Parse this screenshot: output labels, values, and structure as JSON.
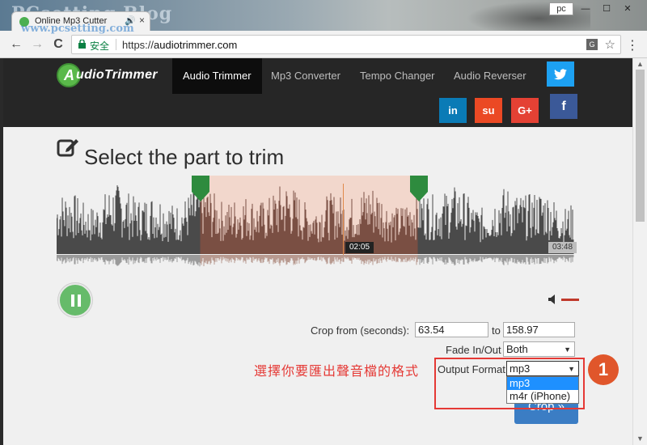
{
  "browser": {
    "watermark_top": "PCsetting Blog",
    "watermark_url": "www.pcsetting.com",
    "tab_title": "Online Mp3 Cutter",
    "tab_audio_icon": "speaker-icon",
    "tab_close": "×",
    "profile": "pc",
    "minimize": "—",
    "maximize": "☐",
    "close": "✕",
    "back": "←",
    "forward": "→",
    "reload": "C",
    "secure_label": "安全",
    "url_scheme": "https://",
    "url_host": "audiotrimmer.com",
    "translate_icon": "G",
    "bookmark": "☆",
    "menu": "⋮"
  },
  "site": {
    "logo_letter": "A",
    "logo_text": "udioTrimmer",
    "nav": [
      {
        "label": "Audio Trimmer",
        "active": true
      },
      {
        "label": "Mp3 Converter",
        "active": false
      },
      {
        "label": "Tempo Changer",
        "active": false
      },
      {
        "label": "Audio Reverser",
        "active": false
      }
    ],
    "social": [
      {
        "label": "twitter",
        "icon": "twitter-icon",
        "color": "#1da1f2"
      },
      {
        "label": "in",
        "icon": "linkedin-icon",
        "color": "#0a7bb6"
      },
      {
        "label": "su",
        "icon": "stumbleupon-icon",
        "color": "#eb4924"
      },
      {
        "label": "G+",
        "icon": "google-plus-icon",
        "color": "#e44134"
      },
      {
        "label": "f",
        "icon": "facebook-icon",
        "color": "#3b5998"
      }
    ]
  },
  "editor": {
    "heading": "Select the part to trim",
    "current_time": "02:05",
    "total_time": "03:48",
    "selection_fraction": [
      0.278,
      0.697
    ],
    "crop_from_label": "Crop from (seconds):",
    "crop_from": "63.54",
    "to_label": "to",
    "crop_to": "158.97",
    "fade_label": "Fade In/Out",
    "fade_value": "Both",
    "format_label": "Output Format",
    "format_value": "mp3",
    "format_options": [
      "mp3",
      "m4r (iPhone)"
    ],
    "crop_button": "Crop »"
  },
  "annotation": {
    "text": "選擇你要匯出聲音檔的格式",
    "number": "1",
    "color": "#e53935"
  }
}
